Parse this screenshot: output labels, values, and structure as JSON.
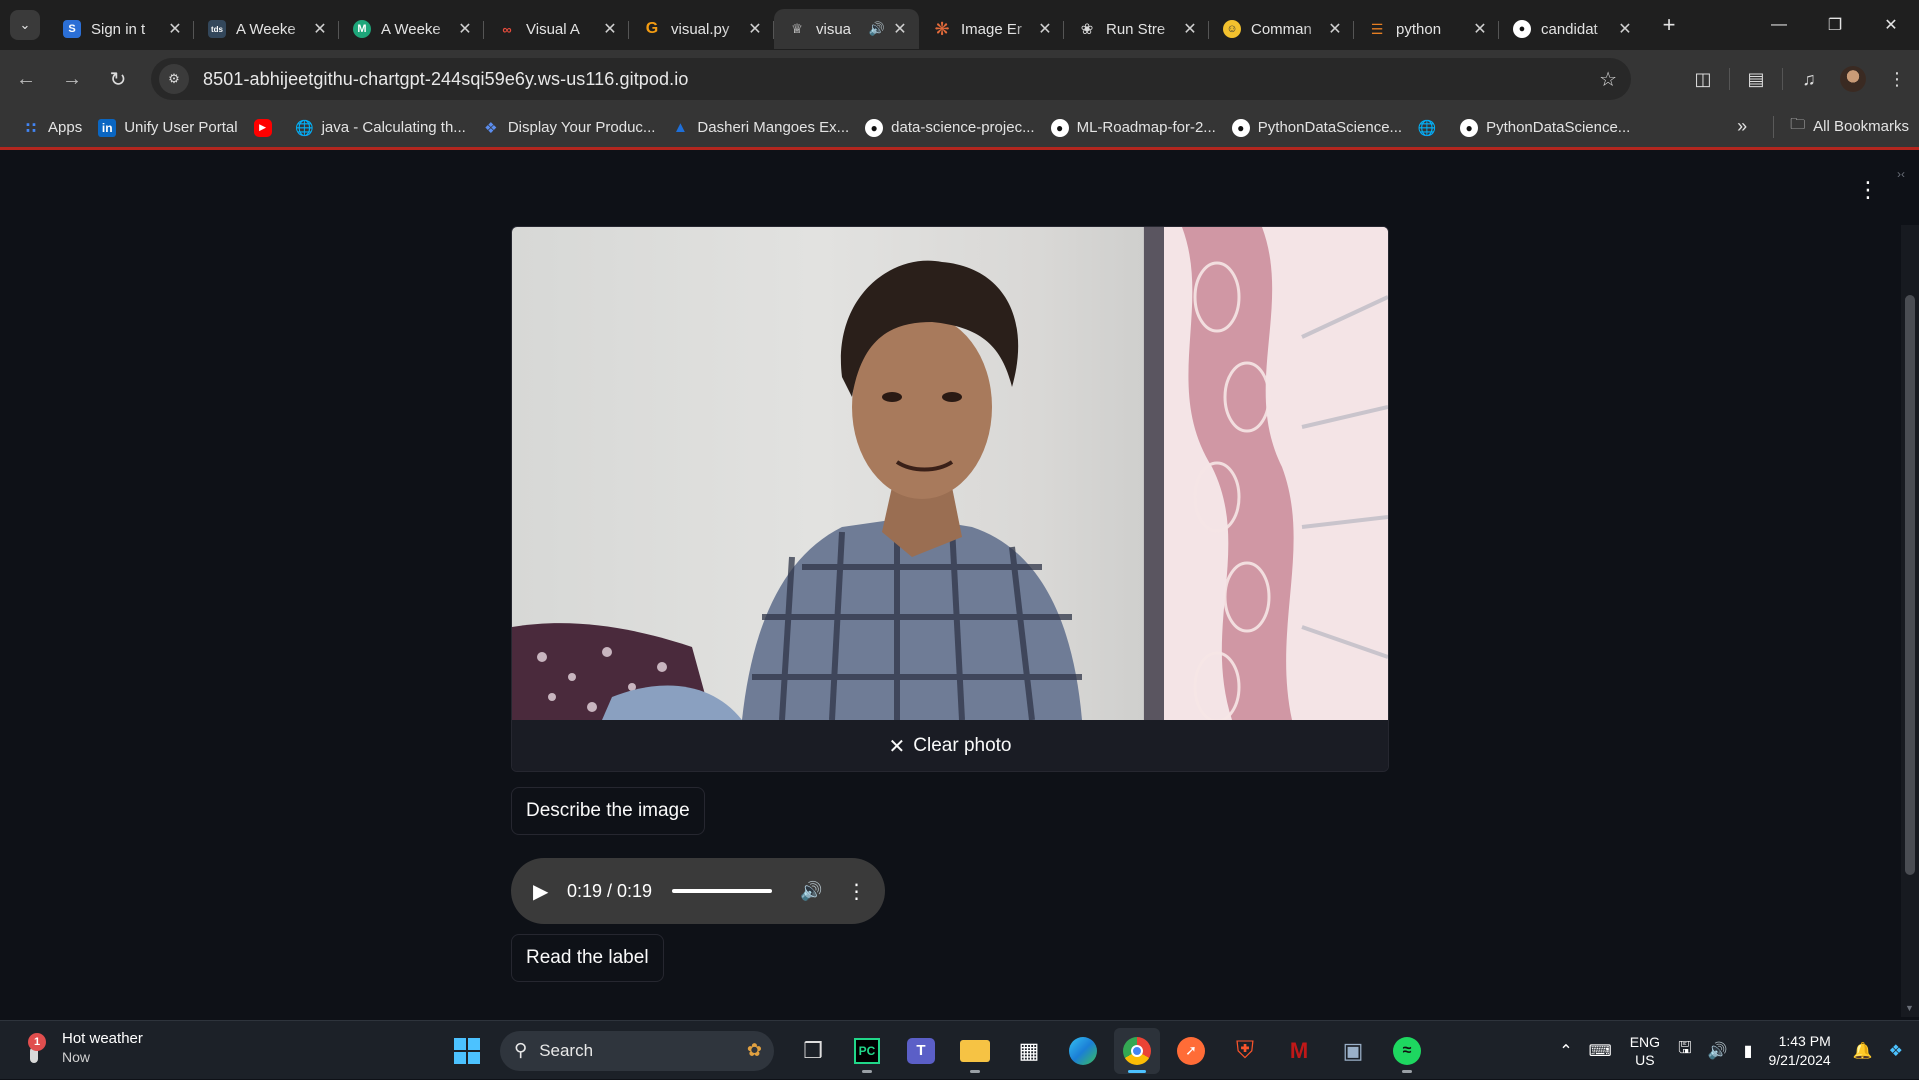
{
  "browser": {
    "tabs": [
      {
        "title": "Sign in t",
        "favicon": "S",
        "color": "#2b6fd6"
      },
      {
        "title": "A Weeke",
        "favicon": "tds",
        "color": "#33475b"
      },
      {
        "title": "A Weeke",
        "favicon": "M",
        "color": "#1ea67a"
      },
      {
        "title": "Visual A",
        "favicon": "co",
        "color": "#c0392b"
      },
      {
        "title": "visual.py",
        "favicon": "G",
        "color": "#e67e22"
      },
      {
        "title": "visua",
        "favicon": "crown",
        "color": "#ffffff",
        "active": true
      },
      {
        "title": "Image Er",
        "favicon": "*",
        "color": "#e26a3a"
      },
      {
        "title": "Run Stre",
        "favicon": "gpt",
        "color": "#d9d9d9"
      },
      {
        "title": "Comman",
        "favicon": "hug",
        "color": "#f2c12e"
      },
      {
        "title": "python",
        "favicon": "py",
        "color": "#e67e22"
      },
      {
        "title": "candidat",
        "favicon": "gh",
        "color": "#ffffff"
      }
    ],
    "url": "8501-abhijeetgithu-chartgpt-244sqi59e6y.ws-us116.gitpod.io",
    "bookmarks": [
      {
        "label": "Apps",
        "icon": "apps-grid-icon"
      },
      {
        "label": "Unify User Portal",
        "icon": "unify-logo-icon"
      },
      {
        "label": "",
        "icon": "youtube-icon"
      },
      {
        "label": "java - Calculating th...",
        "icon": "globe-icon"
      },
      {
        "label": "Display Your Produc...",
        "icon": "product-icon"
      },
      {
        "label": "Dasheri Mangoes Ex...",
        "icon": "triangle-logo-icon"
      },
      {
        "label": "data-science-projec...",
        "icon": "github-icon"
      },
      {
        "label": "ML-Roadmap-for-2...",
        "icon": "github-icon"
      },
      {
        "label": "PythonDataScience...",
        "icon": "github-icon"
      },
      {
        "label": "",
        "icon": "globe-icon"
      },
      {
        "label": "PythonDataScience...",
        "icon": "github-icon"
      }
    ],
    "all_bookmarks": "All Bookmarks"
  },
  "app": {
    "clear_photo": "Clear photo",
    "describe_button": "Describe the image",
    "audio_time": "0:19 / 0:19",
    "audio_progress": 1.0,
    "read_label_button": "Read the label"
  },
  "taskbar": {
    "weather_title": "Hot weather",
    "weather_sub": "Now",
    "weather_badge": "1",
    "search_placeholder": "Search",
    "lang_top": "ENG",
    "lang_bottom": "US",
    "time": "1:43 PM",
    "date": "9/21/2024"
  }
}
